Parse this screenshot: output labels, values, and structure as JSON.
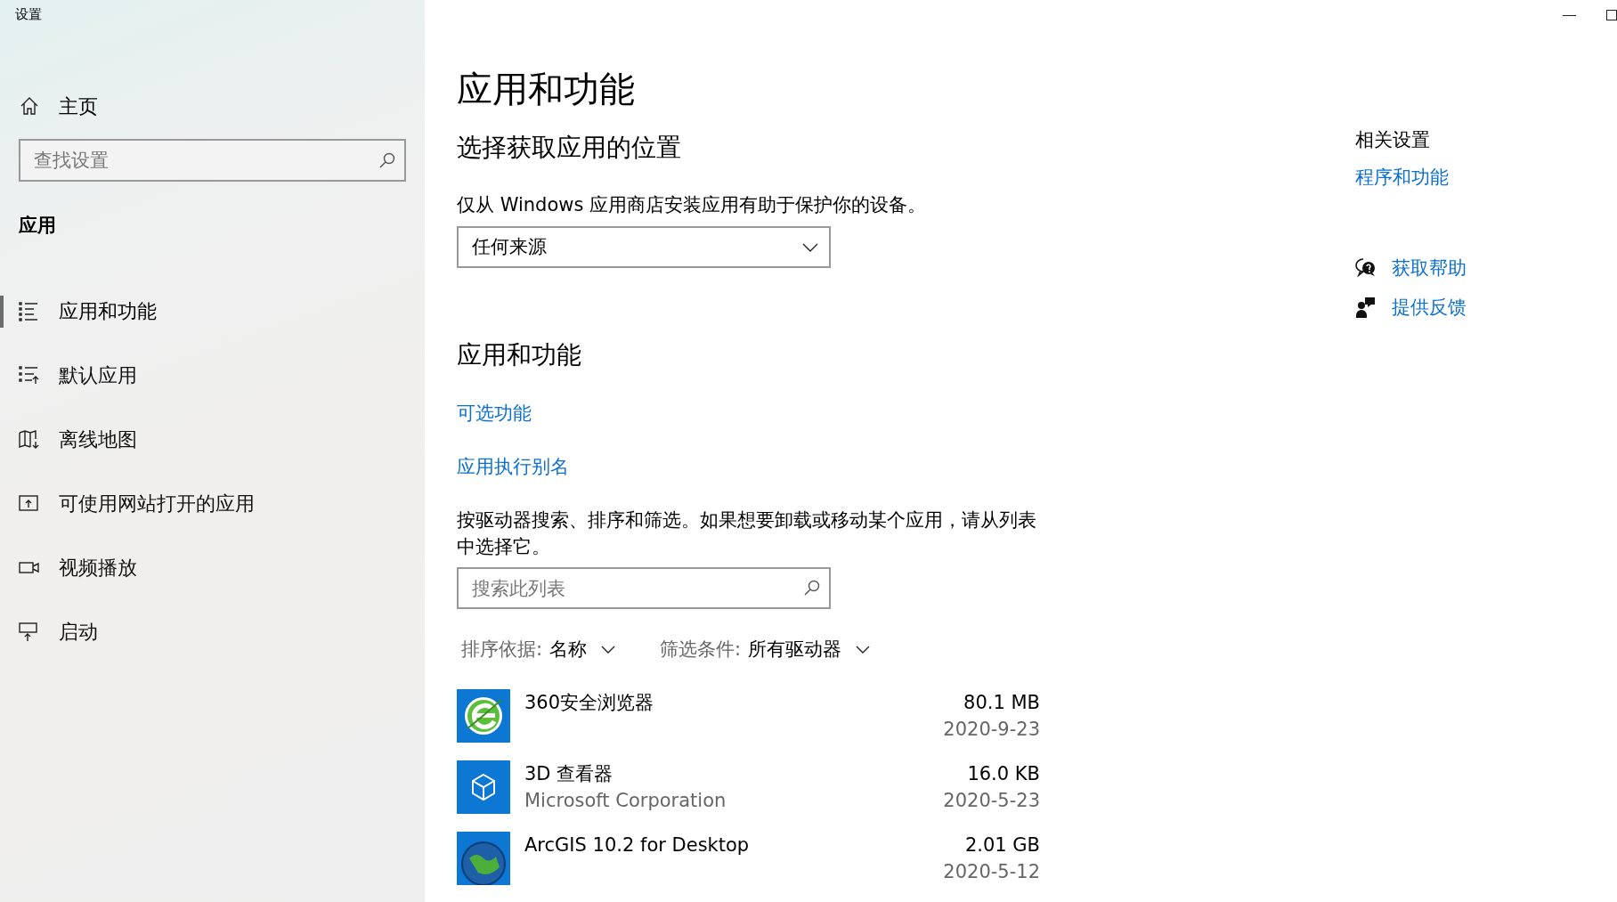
{
  "window": {
    "title": "设置",
    "controls": [
      {
        "kind": "minimize"
      },
      {
        "kind": "maximize"
      }
    ]
  },
  "sidebar": {
    "home": "主页",
    "search": {
      "placeholder": "查找设置"
    },
    "section": "应用",
    "items": [
      {
        "label": "应用和功能",
        "kind": "features",
        "selected": true
      },
      {
        "label": "默认应用",
        "kind": "defaults",
        "selected": false
      },
      {
        "label": "离线地图",
        "kind": "maps",
        "selected": false
      },
      {
        "label": "可使用网站打开的应用",
        "kind": "websites",
        "selected": false
      },
      {
        "label": "视频播放",
        "kind": "video",
        "selected": false
      },
      {
        "label": "启动",
        "kind": "startup",
        "selected": false
      }
    ]
  },
  "main": {
    "title": "应用和功能",
    "install_section": {
      "heading": "选择获取应用的位置",
      "description": "仅从 Windows 应用商店安装应用有助于保护你的设备。",
      "dropdown": {
        "value": "任何来源"
      }
    },
    "apps_section": {
      "heading": "应用和功能",
      "links": [
        "可选功能",
        "应用执行别名"
      ],
      "description": "按驱动器搜索、排序和筛选。如果想要卸载或移动某个应用，请从列表中选择它。",
      "search": {
        "placeholder": "搜索此列表"
      },
      "sort": {
        "label": "排序依据:",
        "value": "名称"
      },
      "filter": {
        "label": "筛选条件:",
        "value": "所有驱动器"
      },
      "apps": [
        {
          "name": "360安全浏览器",
          "kind": "browser",
          "size": "80.1 MB",
          "date": "2020-9-23"
        },
        {
          "name": "3D 查看器",
          "kind": "cube",
          "publisher": "Microsoft Corporation",
          "size": "16.0 KB",
          "date": "2020-5-23"
        },
        {
          "name": "ArcGIS 10.2 for Desktop",
          "kind": "globe",
          "size": "2.01 GB",
          "date": "2020-5-12"
        }
      ]
    }
  },
  "related": {
    "heading": "相关设置",
    "link": "程序和功能",
    "support": [
      {
        "label": "获取帮助",
        "kind": "help"
      },
      {
        "label": "提供反馈",
        "kind": "feedback"
      }
    ]
  }
}
